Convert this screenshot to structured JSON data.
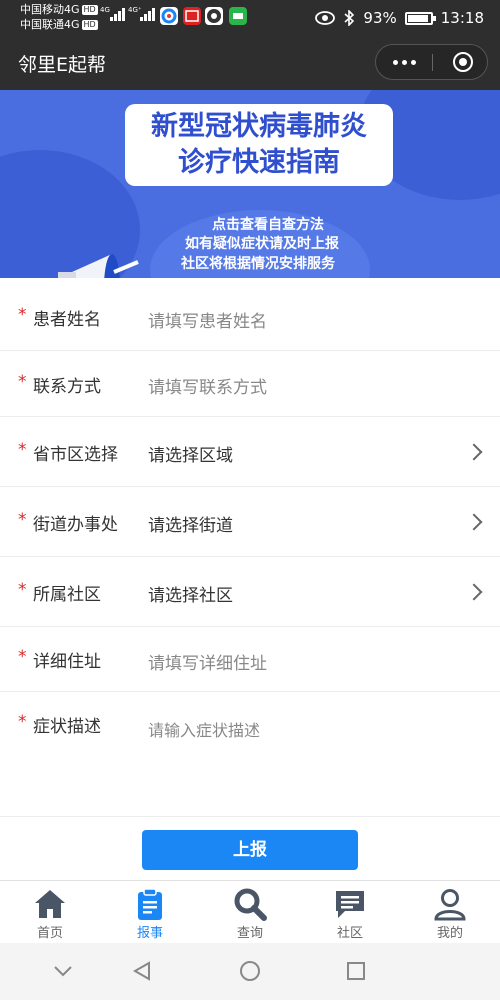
{
  "status_bar": {
    "carrier1": "中国移动4G",
    "carrier2": "中国联通4G",
    "hd": "HD",
    "net1": "4G",
    "net2": "4G⁺",
    "battery": "93%",
    "time": "13:18",
    "battery_level": 0.93
  },
  "app_bar": {
    "title": "邻里E起帮"
  },
  "banner": {
    "title_line1": "新型冠状病毒肺炎",
    "title_line2": "诊疗快速指南",
    "line1": "点击查看自查方法",
    "line2": "如有疑似症状请及时上报",
    "line3": "社区将根据情况安排服务"
  },
  "form": {
    "required_mark": "*",
    "fields": [
      {
        "label": "患者姓名",
        "placeholder": "请填写患者姓名"
      },
      {
        "label": "联系方式",
        "placeholder": "请填写联系方式"
      },
      {
        "label": "省市区选择",
        "placeholder": "请选择区域"
      },
      {
        "label": "街道办事处",
        "placeholder": "请选择街道"
      },
      {
        "label": "所属社区",
        "placeholder": "请选择社区"
      },
      {
        "label": "详细住址",
        "placeholder": "请填写详细住址"
      },
      {
        "label": "症状描述",
        "placeholder": "请输入症状描述"
      }
    ]
  },
  "submit": {
    "label": "上报"
  },
  "tabs": [
    {
      "label": "首页",
      "icon": "home-icon"
    },
    {
      "label": "报事",
      "icon": "clipboard-icon",
      "active": true
    },
    {
      "label": "查询",
      "icon": "search-icon"
    },
    {
      "label": "社区",
      "icon": "chat-icon"
    },
    {
      "label": "我的",
      "icon": "user-icon"
    }
  ],
  "colors": {
    "accent": "#1b87f5",
    "required": "#d9282c",
    "banner": "#4a6ee0",
    "header": "#2e2e2e"
  }
}
